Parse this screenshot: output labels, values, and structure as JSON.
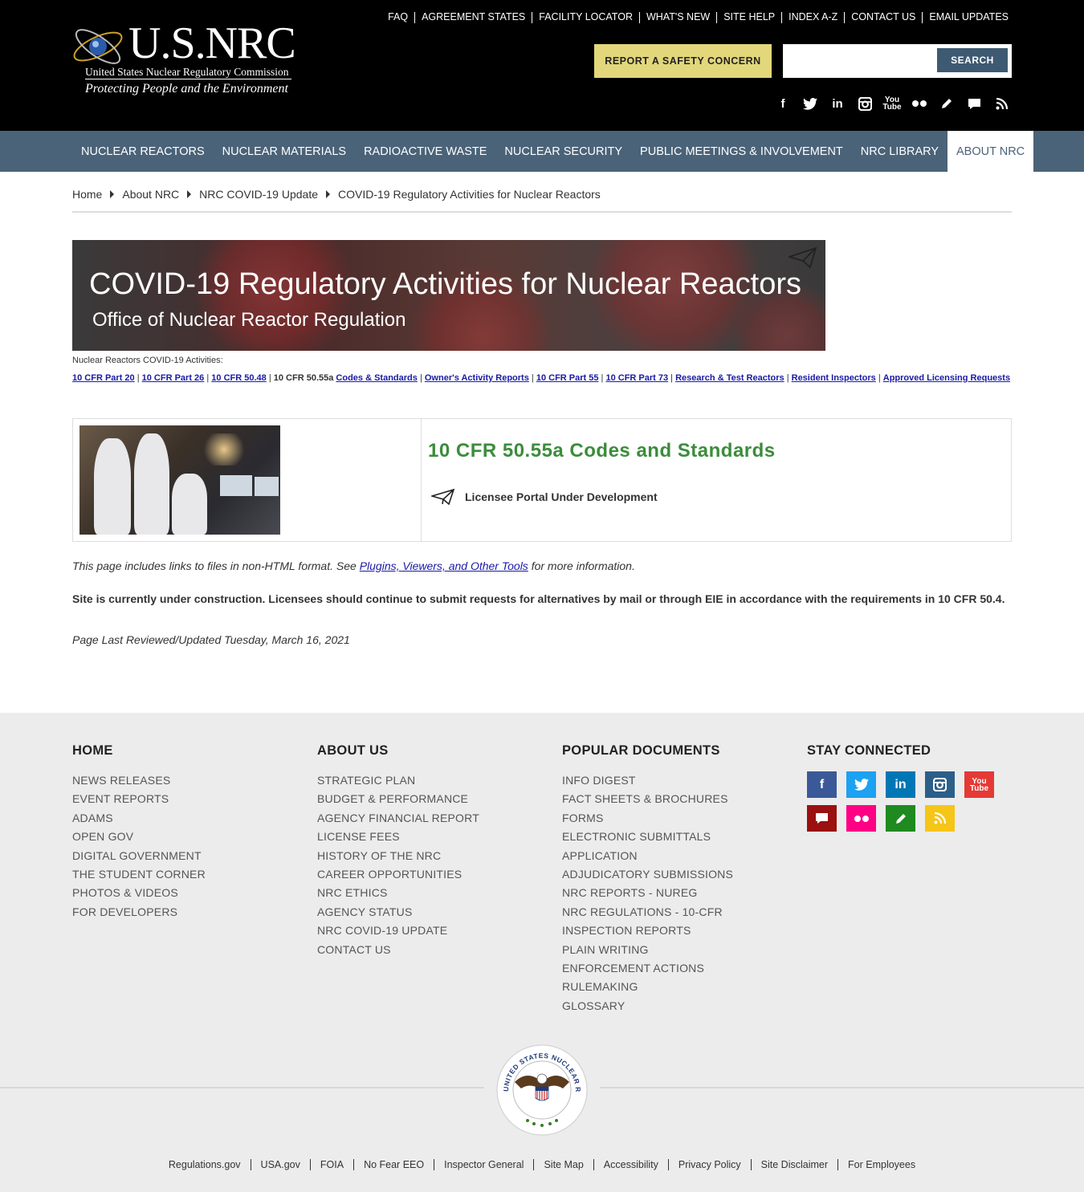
{
  "header": {
    "logo": {
      "title": "U.S.NRC",
      "subtitle": "United States Nuclear Regulatory Commission",
      "tagline": "Protecting People and the Environment"
    },
    "top_links": [
      "FAQ",
      "AGREEMENT STATES",
      "FACILITY LOCATOR",
      "WHAT'S NEW",
      "SITE HELP",
      "INDEX A-Z",
      "CONTACT US",
      "EMAIL UPDATES"
    ],
    "report_button": "REPORT A SAFETY CONCERN",
    "search": {
      "placeholder": "",
      "button": "SEARCH"
    },
    "social_icons": [
      "facebook-icon",
      "twitter-icon",
      "linkedin-icon",
      "instagram-icon",
      "youtube-icon",
      "flickr-icon",
      "blog-icon",
      "comment-icon",
      "rss-icon"
    ]
  },
  "nav": {
    "items": [
      "NUCLEAR REACTORS",
      "NUCLEAR MATERIALS",
      "RADIOACTIVE WASTE",
      "NUCLEAR SECURITY",
      "PUBLIC MEETINGS & INVOLVEMENT",
      "NRC LIBRARY",
      "ABOUT NRC"
    ],
    "active": "ABOUT NRC"
  },
  "breadcrumb": [
    "Home",
    "About NRC",
    "NRC COVID-19 Update",
    "COVID-19 Regulatory Activities for Nuclear Reactors"
  ],
  "banner": {
    "title": "COVID-19 Regulatory Activities for Nuclear Reactors",
    "subtitle": "Office of Nuclear Reactor Regulation"
  },
  "activities": {
    "label": "Nuclear Reactors COVID-19 Activities:",
    "links": [
      {
        "text": "10 CFR Part 20",
        "current": false
      },
      {
        "text": "10 CFR Part 26",
        "current": false
      },
      {
        "text": "10 CFR 50.48",
        "current": false
      },
      {
        "text": "10 CFR 50.55a",
        "current": true
      },
      {
        "text": "Codes & Standards",
        "current": false
      },
      {
        "text": "Owner's Activity Reports",
        "current": false
      },
      {
        "text": "10 CFR Part 55",
        "current": false
      },
      {
        "text": "10 CFR Part 73",
        "current": false
      },
      {
        "text": "Research & Test Reactors",
        "current": false
      },
      {
        "text": "Resident Inspectors",
        "current": false
      },
      {
        "text": "Approved Licensing Requests",
        "current": false
      }
    ]
  },
  "content": {
    "title": "10 CFR 50.55a Codes and Standards",
    "portal": "Licensee Portal Under Development",
    "note_prefix": "This page includes links to files in non-HTML format. See ",
    "note_link": "Plugins, Viewers, and Other Tools",
    "note_suffix": " for more information.",
    "construction": "Site is currently under construction.  Licensees should continue to submit requests for alternatives by mail or through EIE in accordance with the requirements in 10 CFR 50.4.",
    "updated": "Page Last Reviewed/Updated Tuesday, March 16, 2021"
  },
  "footer": {
    "columns": [
      {
        "heading": "HOME",
        "items": [
          "NEWS RELEASES",
          "EVENT REPORTS",
          "ADAMS",
          "OPEN GOV",
          "DIGITAL GOVERNMENT",
          "THE STUDENT CORNER",
          "PHOTOS & VIDEOS",
          "FOR DEVELOPERS"
        ]
      },
      {
        "heading": "ABOUT US",
        "items": [
          "STRATEGIC PLAN",
          "BUDGET & PERFORMANCE",
          "AGENCY FINANCIAL REPORT",
          "LICENSE FEES",
          "HISTORY OF THE NRC",
          "CAREER OPPORTUNITIES",
          "NRC ETHICS",
          "AGENCY STATUS",
          "NRC COVID-19 UPDATE",
          "CONTACT US"
        ]
      },
      {
        "heading": "POPULAR DOCUMENTS",
        "items": [
          "INFO DIGEST",
          "FACT SHEETS & BROCHURES",
          "FORMS",
          "ELECTRONIC SUBMITTALS",
          "APPLICATION",
          "ADJUDICATORY SUBMISSIONS",
          "NRC REPORTS - NUREG",
          "NRC REGULATIONS - 10-CFR",
          "INSPECTION REPORTS",
          "PLAIN WRITING",
          "ENFORCEMENT ACTIONS",
          "RULEMAKING",
          "GLOSSARY"
        ]
      }
    ],
    "stay_connected": "STAY CONNECTED",
    "social": [
      {
        "icon": "facebook-icon",
        "color": "#3b5998"
      },
      {
        "icon": "twitter-icon",
        "color": "#1da1f2"
      },
      {
        "icon": "linkedin-icon",
        "color": "#0077b5"
      },
      {
        "icon": "instagram-icon",
        "color": "#2b5f8a"
      },
      {
        "icon": "youtube-icon",
        "color": "#e53935"
      },
      {
        "icon": "comment-icon",
        "color": "#9b1010"
      },
      {
        "icon": "flickr-icon",
        "color": "#ff0084"
      },
      {
        "icon": "blog-icon",
        "color": "#1f8a1f"
      },
      {
        "icon": "rss-icon",
        "color": "#f5c518"
      }
    ],
    "seal_text": "UNITED STATES NUCLEAR REGULATORY COMMISSION",
    "bottom_links": [
      "Regulations.gov",
      "USA.gov",
      "FOIA",
      "No Fear EEO",
      "Inspector General",
      "Site Map",
      "Accessibility",
      "Privacy Policy",
      "Site Disclaimer",
      "For Employees"
    ]
  }
}
